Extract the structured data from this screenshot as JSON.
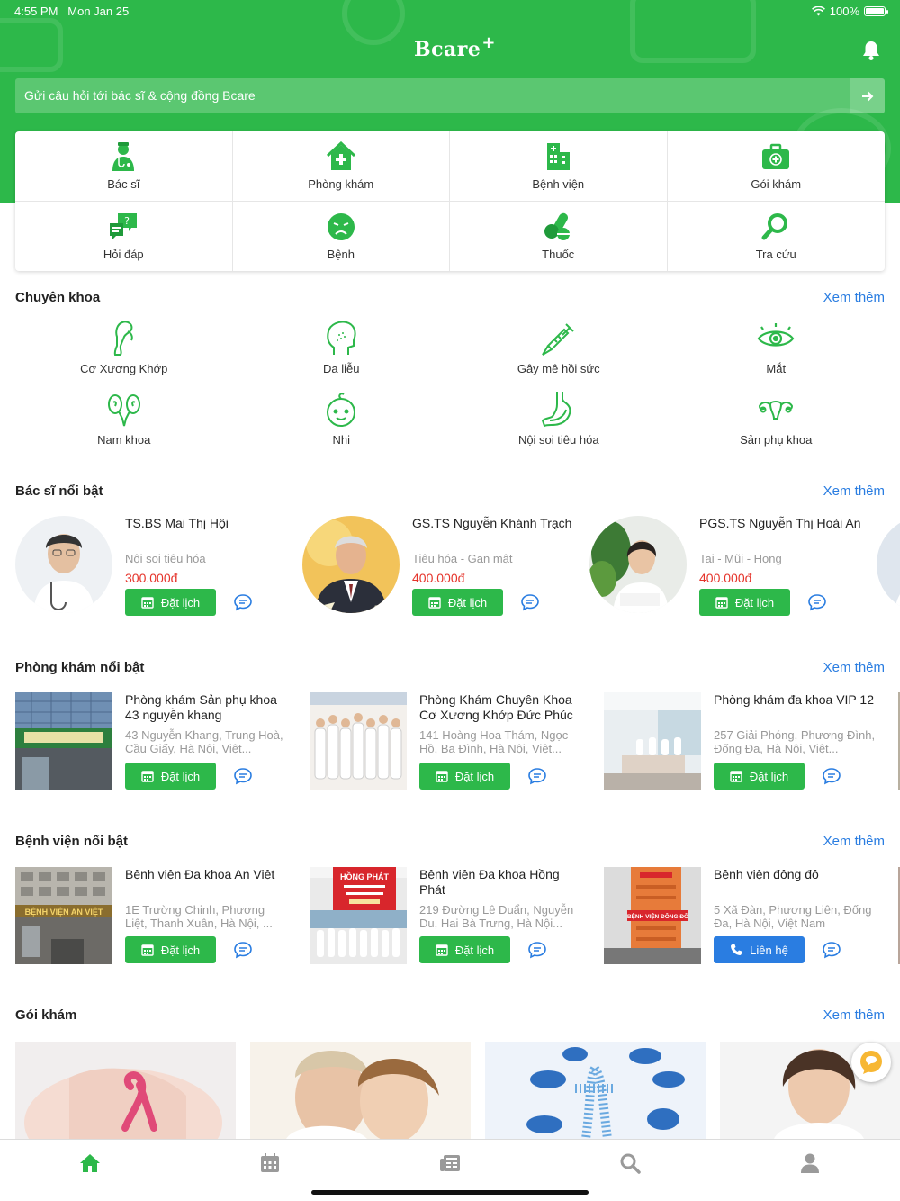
{
  "status": {
    "time": "4:55 PM",
    "date": "Mon Jan 25",
    "battery": "100%"
  },
  "brand": {
    "name": "Bcare",
    "plus": "+"
  },
  "colors": {
    "primary": "#2db84a",
    "link": "#2a7de1",
    "price": "#e5332a",
    "muted": "#999999"
  },
  "search": {
    "placeholder": "Gửi câu hỏi tới bác sĩ & cộng đồng Bcare"
  },
  "quick_links": [
    {
      "label": "Bác sĩ",
      "icon": "doctor-icon"
    },
    {
      "label": "Phòng khám",
      "icon": "clinic-icon"
    },
    {
      "label": "Bệnh viện",
      "icon": "hospital-icon"
    },
    {
      "label": "Gói khám",
      "icon": "medical-kit-icon"
    },
    {
      "label": "Hỏi đáp",
      "icon": "qa-icon"
    },
    {
      "label": "Bệnh",
      "icon": "sick-face-icon"
    },
    {
      "label": "Thuốc",
      "icon": "pills-icon"
    },
    {
      "label": "Tra cứu",
      "icon": "lookup-icon"
    }
  ],
  "specialties": {
    "title": "Chuyên khoa",
    "more": "Xem thêm",
    "items": [
      {
        "label": "Cơ Xương Khớp",
        "icon": "bone-icon"
      },
      {
        "label": "Da liễu",
        "icon": "dermatology-icon"
      },
      {
        "label": "Gây mê hồi sức",
        "icon": "syringe-icon"
      },
      {
        "label": "Mắt",
        "icon": "eye-icon"
      },
      {
        "label": "Nam khoa",
        "icon": "andrology-icon"
      },
      {
        "label": "Nhi",
        "icon": "baby-icon"
      },
      {
        "label": "Nội soi tiêu hóa",
        "icon": "stomach-icon"
      },
      {
        "label": "Sản phụ khoa",
        "icon": "uterus-icon"
      }
    ]
  },
  "doctors": {
    "title": "Bác sĩ nổi bật",
    "more": "Xem thêm",
    "book_label": "Đặt lịch",
    "items": [
      {
        "name": "TS.BS Mai Thị Hội",
        "specialty": "Nội soi tiêu hóa",
        "price": "300.000đ"
      },
      {
        "name": "GS.TS Nguyễn Khánh Trạch",
        "specialty": "Tiêu hóa - Gan mật",
        "price": "400.000đ"
      },
      {
        "name": "PGS.TS Nguyễn Thị Hoài An",
        "specialty": "Tai - Mũi - Họng",
        "price": "400.000đ"
      }
    ]
  },
  "clinics": {
    "title": "Phòng khám nổi bật",
    "more": "Xem thêm",
    "book_label": "Đặt lịch",
    "items": [
      {
        "name": "Phòng khám Sản phụ khoa 43 nguyễn khang",
        "address": "43 Nguyễn Khang, Trung Hoà, Cầu Giấy, Hà Nội, Việt..."
      },
      {
        "name": "Phòng Khám Chuyên Khoa Cơ Xương Khớp Đức Phúc",
        "address": "141 Hoàng Hoa Thám, Ngọc Hồ, Ba Đình, Hà Nội, Việt..."
      },
      {
        "name": "Phòng khám đa khoa VIP 12",
        "address": "257 Giải Phóng, Phương Đình, Đống Đa, Hà Nội, Việt..."
      }
    ]
  },
  "hospitals": {
    "title": "Bệnh viện nổi bật",
    "more": "Xem thêm",
    "book_label": "Đặt lịch",
    "call_label": "Liên hệ",
    "items": [
      {
        "name": "Bệnh viện Đa khoa An Việt",
        "address": "1E Trường Chinh, Phương Liệt, Thanh Xuân, Hà Nội, ...",
        "sign": "BỆNH VIỆN AN VIỆT"
      },
      {
        "name": "Bệnh viện Đa khoa Hồng Phát",
        "address": "219 Đường Lê Duẩn, Nguyễn Du, Hai Bà Trưng, Hà Nội...",
        "sign": "HỒNG PHÁT"
      },
      {
        "name": "Bệnh viện đông đô",
        "address": "5 Xã Đàn, Phương Liên, Đống Đa, Hà Nội, Việt Nam",
        "sign": "BỆNH VIỆN ĐÔNG ĐÔ"
      }
    ]
  },
  "packages": {
    "title": "Gói khám",
    "more": "Xem thêm"
  },
  "tabs": [
    {
      "name": "home",
      "icon": "home-icon",
      "active": true
    },
    {
      "name": "calendar",
      "icon": "calendar-icon",
      "active": false
    },
    {
      "name": "news",
      "icon": "news-icon",
      "active": false
    },
    {
      "name": "search",
      "icon": "search-icon",
      "active": false
    },
    {
      "name": "profile",
      "icon": "user-icon",
      "active": false
    }
  ]
}
